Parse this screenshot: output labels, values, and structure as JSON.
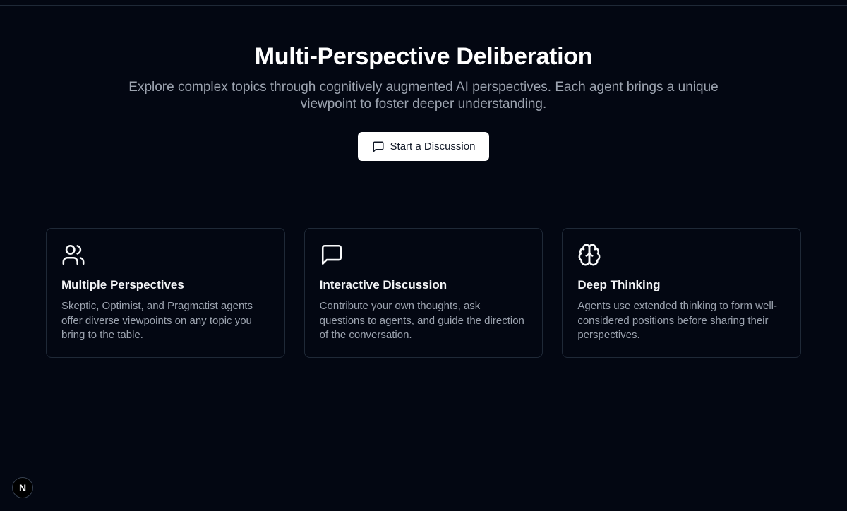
{
  "hero": {
    "title": "Multi-Perspective Deliberation",
    "subtitle": "Explore complex topics through cognitively augmented AI perspectives. Each agent brings a unique viewpoint to foster deeper understanding.",
    "cta_label": "Start a Discussion",
    "cta_icon": "message-square-icon"
  },
  "features": [
    {
      "icon": "users-icon",
      "title": "Multiple Perspectives",
      "description": "Skeptic, Optimist, and Pragmatist agents offer diverse viewpoints on any topic you bring to the table."
    },
    {
      "icon": "message-square-icon",
      "title": "Interactive Discussion",
      "description": "Contribute your own thoughts, ask questions to agents, and guide the direction of the conversation."
    },
    {
      "icon": "brain-icon",
      "title": "Deep Thinking",
      "description": "Agents use extended thinking to form well-considered positions before sharing their perspectives."
    }
  ],
  "dev_badge": {
    "label": "N"
  },
  "colors": {
    "background": "#030712",
    "card_border": "#1f2937",
    "muted_text": "#9ca3af",
    "button_bg": "#ffffff"
  }
}
